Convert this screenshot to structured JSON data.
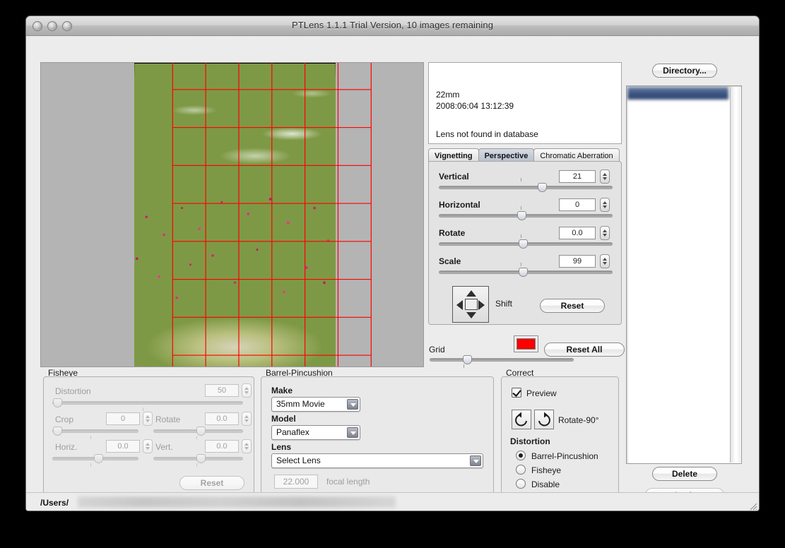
{
  "window": {
    "title": "PTLens 1.1.1 Trial Version, 10 images remaining",
    "traffic_lights": [
      "close-button",
      "minimize-button",
      "zoom-button"
    ]
  },
  "info_panel": {
    "focal_length": "22mm",
    "timestamp": "2008:06:04 13:12:39",
    "message": "Lens not found in database"
  },
  "tabs": [
    {
      "label": "Vignetting",
      "selected": false
    },
    {
      "label": "Perspective",
      "selected": true
    },
    {
      "label": "Chromatic Aberration",
      "selected": false
    }
  ],
  "perspective": {
    "controls": [
      {
        "label": "Vertical",
        "value": "21",
        "thumb_pct": 57
      },
      {
        "label": "Horizontal",
        "value": "0",
        "thumb_pct": 47
      },
      {
        "label": "Rotate",
        "value": "0.0",
        "thumb_pct": 47
      },
      {
        "label": "Scale",
        "value": "99",
        "thumb_pct": 47
      }
    ],
    "shift_label": "Shift",
    "reset_label": "Reset"
  },
  "grid": {
    "label": "Grid",
    "thumb_pct": 23,
    "color": "#ff0000",
    "reset_all_label": "Reset All"
  },
  "right_column": {
    "directory_label": "Directory...",
    "delete_label": "Delete",
    "apply_label": "Apply"
  },
  "fisheye": {
    "title": "Fisheye",
    "distortion": {
      "label": "Distortion",
      "value": "50",
      "thumb_pct": 1
    },
    "crop": {
      "label": "Crop",
      "value": "0",
      "thumb_pct": 1
    },
    "rotate": {
      "label": "Rotate",
      "value": "0.0",
      "thumb_pct": 48
    },
    "horiz": {
      "label": "Horiz.",
      "value": "0.0",
      "thumb_pct": 48
    },
    "vert": {
      "label": "Vert.",
      "value": "0.0",
      "thumb_pct": 48
    },
    "reset_label": "Reset"
  },
  "barrel": {
    "title": "Barrel-Pincushion",
    "make_label": "Make",
    "make_value": "35mm Movie",
    "model_label": "Model",
    "model_value": "Panaflex",
    "lens_label": "Lens",
    "lens_value": "Select Lens",
    "focal_value": "22.000",
    "focal_label": "focal length"
  },
  "correct": {
    "title": "Correct",
    "preview_label": "Preview",
    "preview_checked": true,
    "rotate_label": "Rotate-90°",
    "distortion_label": "Distortion",
    "options": [
      {
        "label": "Barrel-Pincushion",
        "selected": true
      },
      {
        "label": "Fisheye",
        "selected": false
      },
      {
        "label": "Disable",
        "selected": false
      }
    ]
  },
  "status": {
    "path_prefix": "/Users/"
  }
}
